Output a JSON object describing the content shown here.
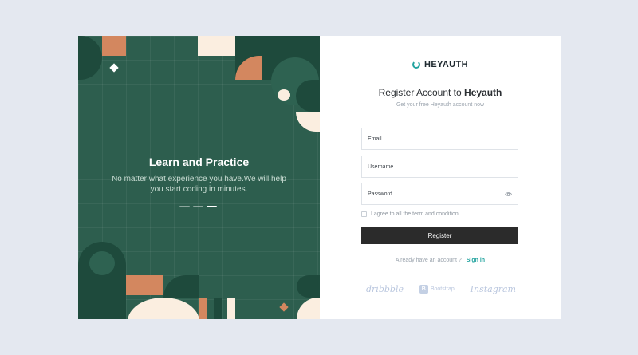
{
  "hero": {
    "title": "Learn and Practice",
    "subtitle": "No matter what experience you have.We will help you start coding in minutes.",
    "slides_total": 3,
    "active_slide": 3
  },
  "brand": {
    "name": "HEYAUTH",
    "accent": "#22a39f"
  },
  "form": {
    "heading_prefix": "Register Account to",
    "heading_brand": "Heyauth",
    "subheading": "Get your free Heyauth account now",
    "email_placeholder": "Email",
    "username_placeholder": "Username",
    "password_placeholder": "Password",
    "terms_label": "I agree to all the term and condition.",
    "terms_checked": false,
    "submit_label": "Register",
    "signin_prompt": "Already have an account ?",
    "signin_link": "Sign in"
  },
  "partners": [
    "dribbble",
    "Bootstrap",
    "Instagram"
  ],
  "colors": {
    "panel": "#2d5e4e",
    "dark_green": "#1e4a3c",
    "salmon": "#d3875f",
    "cream": "#fbeee0",
    "button": "#2b2b2b"
  }
}
